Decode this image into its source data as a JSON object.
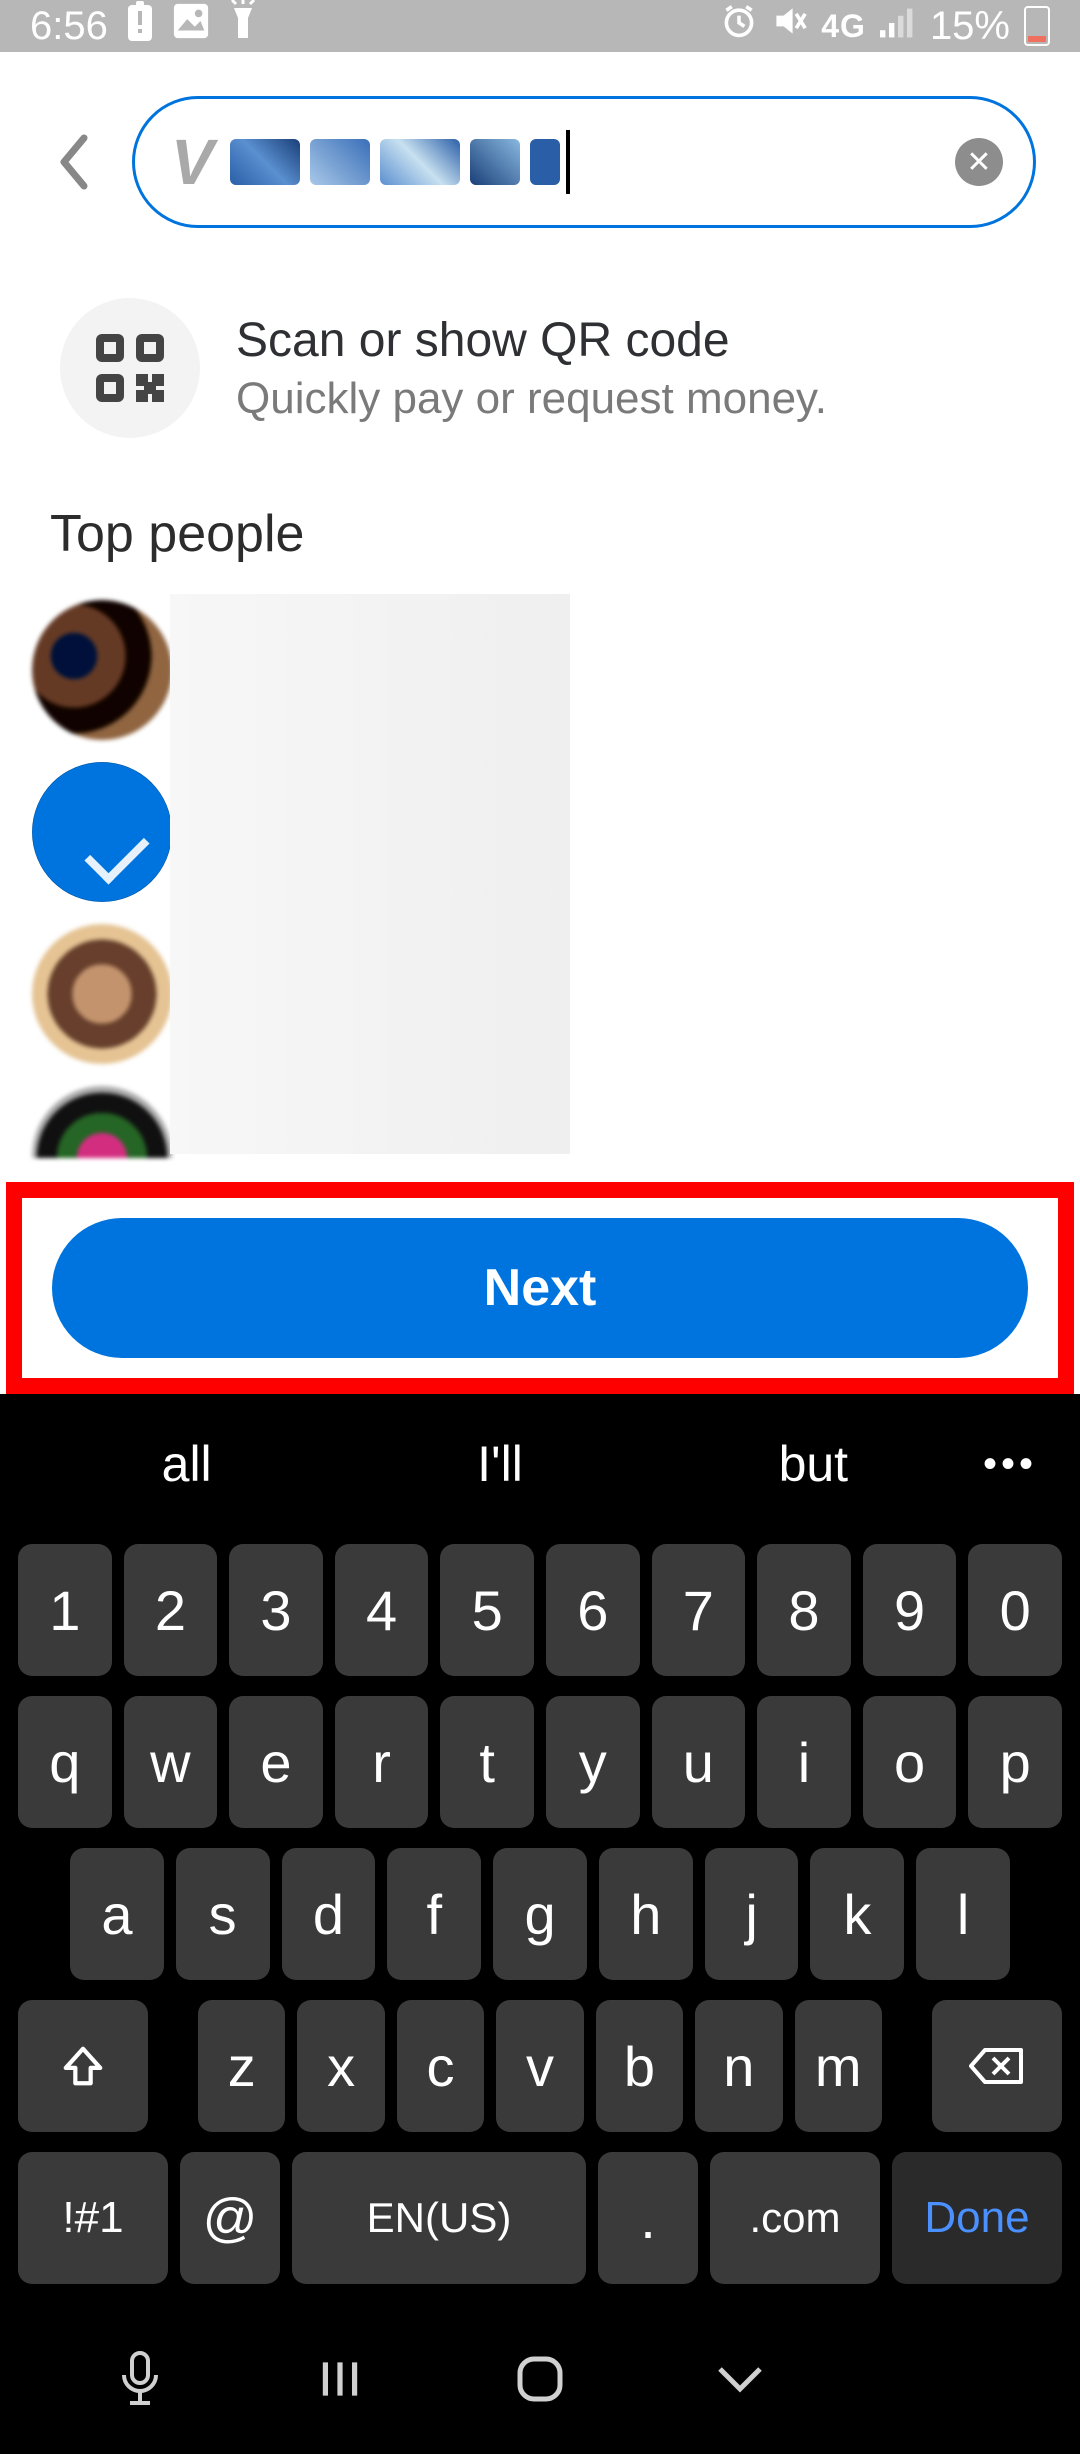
{
  "status": {
    "time": "6:56",
    "network_label": "4G",
    "battery_pct": "15%"
  },
  "search": {
    "clear_label": "✕"
  },
  "qr": {
    "title": "Scan or show QR code",
    "subtitle": "Quickly pay or request money."
  },
  "section": {
    "top_people": "Top people"
  },
  "cta": {
    "next": "Next"
  },
  "keyboard": {
    "suggestions": [
      "all",
      "I'll",
      "but"
    ],
    "row1": [
      "1",
      "2",
      "3",
      "4",
      "5",
      "6",
      "7",
      "8",
      "9",
      "0"
    ],
    "row2": [
      "q",
      "w",
      "e",
      "r",
      "t",
      "y",
      "u",
      "i",
      "o",
      "p"
    ],
    "row3": [
      "a",
      "s",
      "d",
      "f",
      "g",
      "h",
      "j",
      "k",
      "l"
    ],
    "row4": [
      "z",
      "x",
      "c",
      "v",
      "b",
      "n",
      "m"
    ],
    "sym": "!#1",
    "at": "@",
    "space": "EN(US)",
    "period": ".",
    "com": ".com",
    "done": "Done"
  }
}
